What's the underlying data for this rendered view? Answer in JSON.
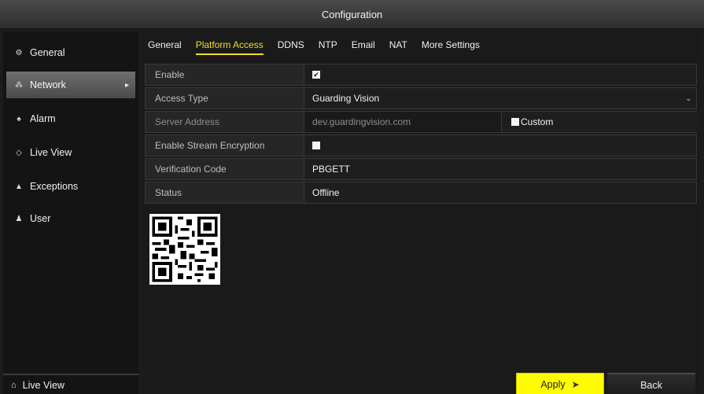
{
  "window": {
    "title": "Configuration"
  },
  "sidebar": {
    "items": [
      {
        "label": "General",
        "icon": "gear-icon",
        "glyph": "⚙"
      },
      {
        "label": "Network",
        "icon": "network-icon",
        "glyph": "⁂"
      },
      {
        "label": "Alarm",
        "icon": "alarm-icon",
        "glyph": "♠"
      },
      {
        "label": "Live View",
        "icon": "live-view-icon",
        "glyph": "◇"
      },
      {
        "label": "Exceptions",
        "icon": "warning-icon",
        "glyph": "▲"
      },
      {
        "label": "User",
        "icon": "user-icon",
        "glyph": "♟"
      }
    ],
    "active_index": 1,
    "bottom": {
      "label": "Live View",
      "icon": "home-icon",
      "glyph": "⌂"
    }
  },
  "tabs": [
    "General",
    "Platform Access",
    "DDNS",
    "NTP",
    "Email",
    "NAT",
    "More Settings"
  ],
  "active_tab": "Platform Access",
  "form": {
    "enable": {
      "label": "Enable",
      "checked": true
    },
    "access_type": {
      "label": "Access Type",
      "value": "Guarding Vision"
    },
    "server_address": {
      "label": "Server Address",
      "value": "dev.guardingvision.com",
      "custom_label": "Custom"
    },
    "stream_encryption": {
      "label": "Enable Stream Encryption",
      "checked": false
    },
    "verification_code": {
      "label": "Verification Code",
      "value": "PBGETT"
    },
    "status": {
      "label": "Status",
      "value": "Offline"
    }
  },
  "buttons": {
    "apply": "Apply",
    "back": "Back"
  },
  "colors": {
    "accent": "#f3dd2a",
    "apply_bg": "#fffb00"
  }
}
